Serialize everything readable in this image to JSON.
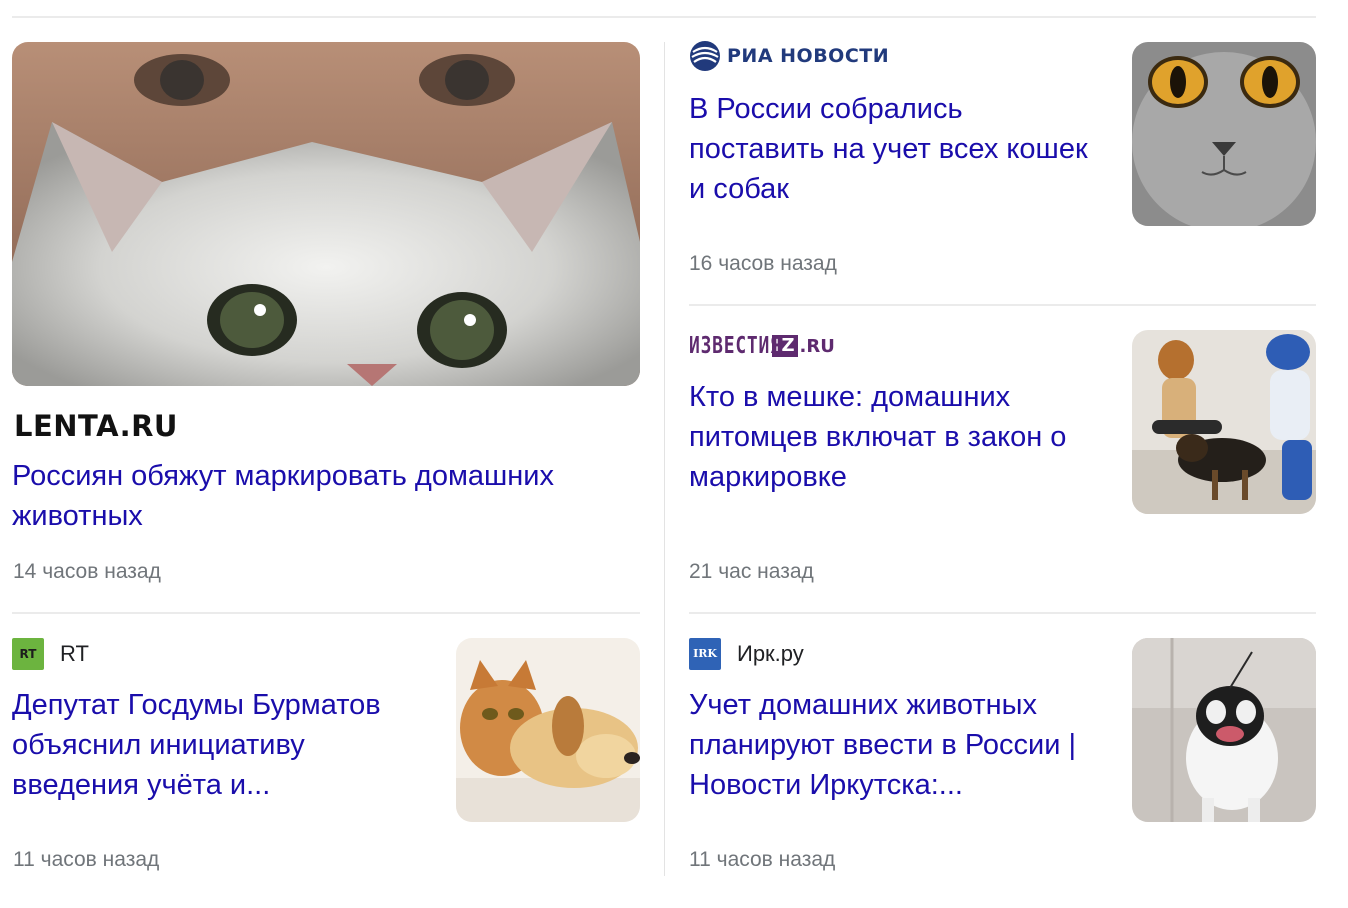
{
  "articles": [
    {
      "source": "LENTA.RU",
      "title": "Россиян обяжут маркировать домашних животных",
      "time": "14 часов назад"
    },
    {
      "source": "РИА НОВОСТИ",
      "title": "В России собрались поставить на учет всех кошек и собак",
      "time": "16 часов назад"
    },
    {
      "source": "ИЗВЕСТИЯ",
      "source_iz": "IZ",
      "source_ru": ".RU",
      "title": "Кто в мешке: домашних питомцев включат в закон о маркировке",
      "time": "21 час назад"
    },
    {
      "source": "RT",
      "source_icon": "RT",
      "title": "Депутат Госдумы Бурматов объяснил инициативу введения учёта и...",
      "time": "11 часов назад"
    },
    {
      "source": "Ирк.ру",
      "source_icon": "IRK",
      "title": "Учет домашних животных планируют ввести в России | Новости Иркутска:...",
      "time": "11 часов назад"
    }
  ],
  "icons": {
    "ria": "ria-novosti-globe-icon",
    "rt": "rt-logo-icon",
    "irk": "irk-logo-icon"
  },
  "colors": {
    "link": "#1a0dab",
    "meta": "#70757a",
    "rt_green": "#6cb43f",
    "irk_blue": "#2f63b6",
    "ria_blue": "#213a7c",
    "izvestia_purple": "#5e2a6f"
  }
}
